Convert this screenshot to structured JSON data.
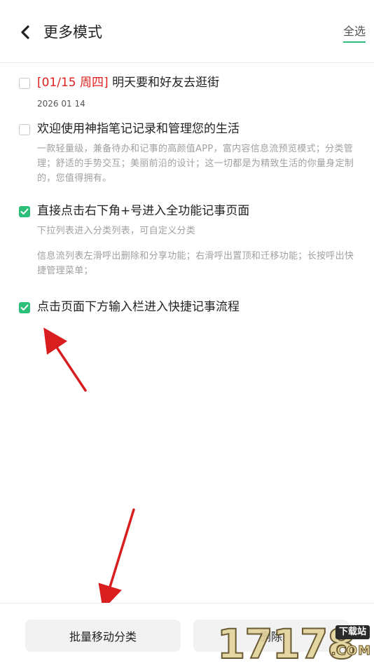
{
  "header": {
    "title": "更多模式",
    "select_all": "全选"
  },
  "notes": [
    {
      "tag": "[01/15 周四]",
      "title": "明天要和好友去逛街",
      "date": "2026 01 14",
      "checked": false
    },
    {
      "title": "欢迎使用神指笔记记录和管理您的生活",
      "body": "一款轻量级，兼备待办和记事的高颜值APP，富内容信息流预览模式；分类管理；舒适的手势交互；美丽前沿的设计；这一切都是为精致生活的你量身定制的，您值得拥有。",
      "checked": false
    },
    {
      "title": "直接点击右下角+号进入全功能记事页面",
      "body": "下拉列表进入分类列表，可自定义分类",
      "body2": "信息流列表左滑呼出删除和分享功能；右滑呼出置顶和迁移功能；长按呼出快捷管理菜单；",
      "checked": true
    },
    {
      "title": "点击页面下方输入栏进入快捷记事流程",
      "checked": true
    }
  ],
  "bottom": {
    "move_label": "批量移动分类",
    "delete_label": "删除"
  },
  "watermark": {
    "digits": "17178",
    "label": "下载站",
    "sub": ".COM"
  },
  "colors": {
    "accent": "#2bbf7a",
    "tag": "#e02020",
    "arrow": "#d81e1e"
  }
}
